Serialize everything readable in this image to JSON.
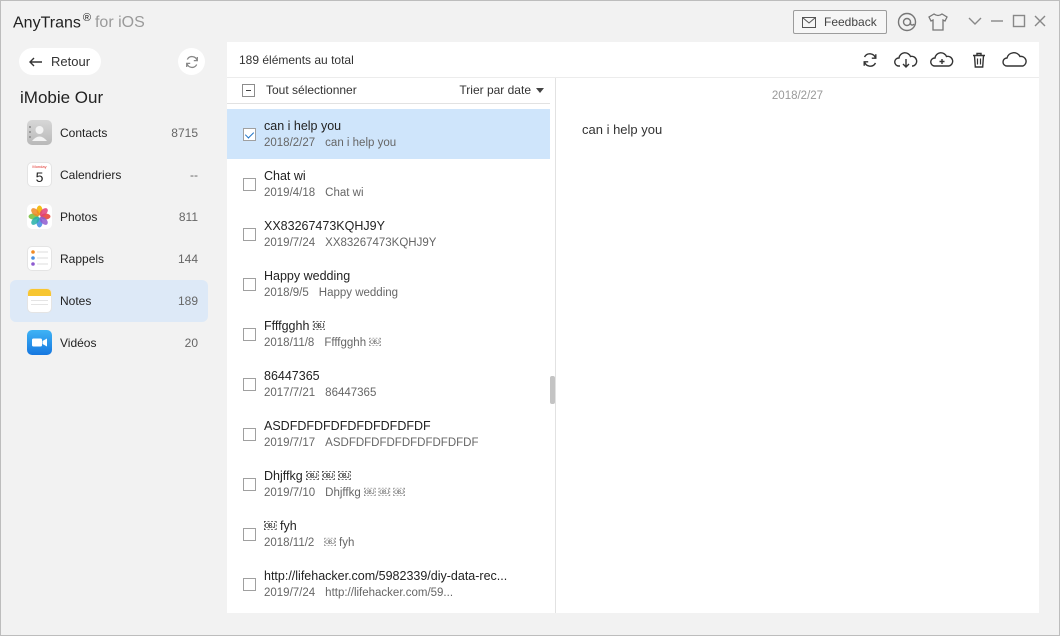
{
  "app": {
    "name": "AnyTrans",
    "reg": "®",
    "platform": "for iOS"
  },
  "titlebar": {
    "feedback_label": "Feedback"
  },
  "sidebar": {
    "back_label": "Retour",
    "device_name": "iMobie Our",
    "categories": [
      {
        "label": "Contacts",
        "count": "8715",
        "icon": "contacts-icon"
      },
      {
        "label": "Calendriers",
        "count": "--",
        "icon": "calendar-icon",
        "icon_day": "5",
        "icon_weekday": "Monday"
      },
      {
        "label": "Photos",
        "count": "811",
        "icon": "photos-icon"
      },
      {
        "label": "Rappels",
        "count": "144",
        "icon": "reminders-icon"
      },
      {
        "label": "Notes",
        "count": "189",
        "icon": "notes-icon",
        "active": true
      },
      {
        "label": "Vidéos",
        "count": "20",
        "icon": "videos-icon"
      }
    ]
  },
  "main": {
    "total": "189 éléments au total",
    "select_all": "Tout sélectionner",
    "sort_label": "Trier par date",
    "notes": [
      {
        "title": "can i help you",
        "date": "2018/2/27",
        "preview": "can i help you",
        "selected": true
      },
      {
        "title": "Chat wi",
        "date": "2019/4/18",
        "preview": "Chat wi"
      },
      {
        "title": "XX83267473KQHJ9Y",
        "date": "2019/7/24",
        "preview": "XX83267473KQHJ9Y"
      },
      {
        "title": "Happy wedding",
        "date": "2018/9/5",
        "preview": "Happy wedding"
      },
      {
        "title": "Ffffgghh ￼",
        "date": "2018/11/8",
        "preview": "Ffffgghh ￼"
      },
      {
        "title": "86447365",
        "date": "2017/7/21",
        "preview": "86447365"
      },
      {
        "title": "ASDFDFDFDFDFDFDFDFDF",
        "date": "2019/7/17",
        "preview": "ASDFDFDFDFDFDFDFDFDF"
      },
      {
        "title": "Dhjffkg ￼ ￼ ￼",
        "date": "2019/7/10",
        "preview": "Dhjffkg ￼ ￼ ￼"
      },
      {
        "title": "￼ fyh",
        "date": "2018/11/2",
        "preview": "￼ fyh"
      },
      {
        "title": "http://lifehacker.com/5982339/diy-data-rec...",
        "date": "2019/7/24",
        "preview": "http://lifehacker.com/59..."
      }
    ],
    "detail": {
      "date": "2018/2/27",
      "body": "can i help you"
    }
  },
  "colors": {
    "accent": "#1f74c7",
    "selected_row": "#cfe5fb",
    "active_category": "#dde9f7"
  }
}
